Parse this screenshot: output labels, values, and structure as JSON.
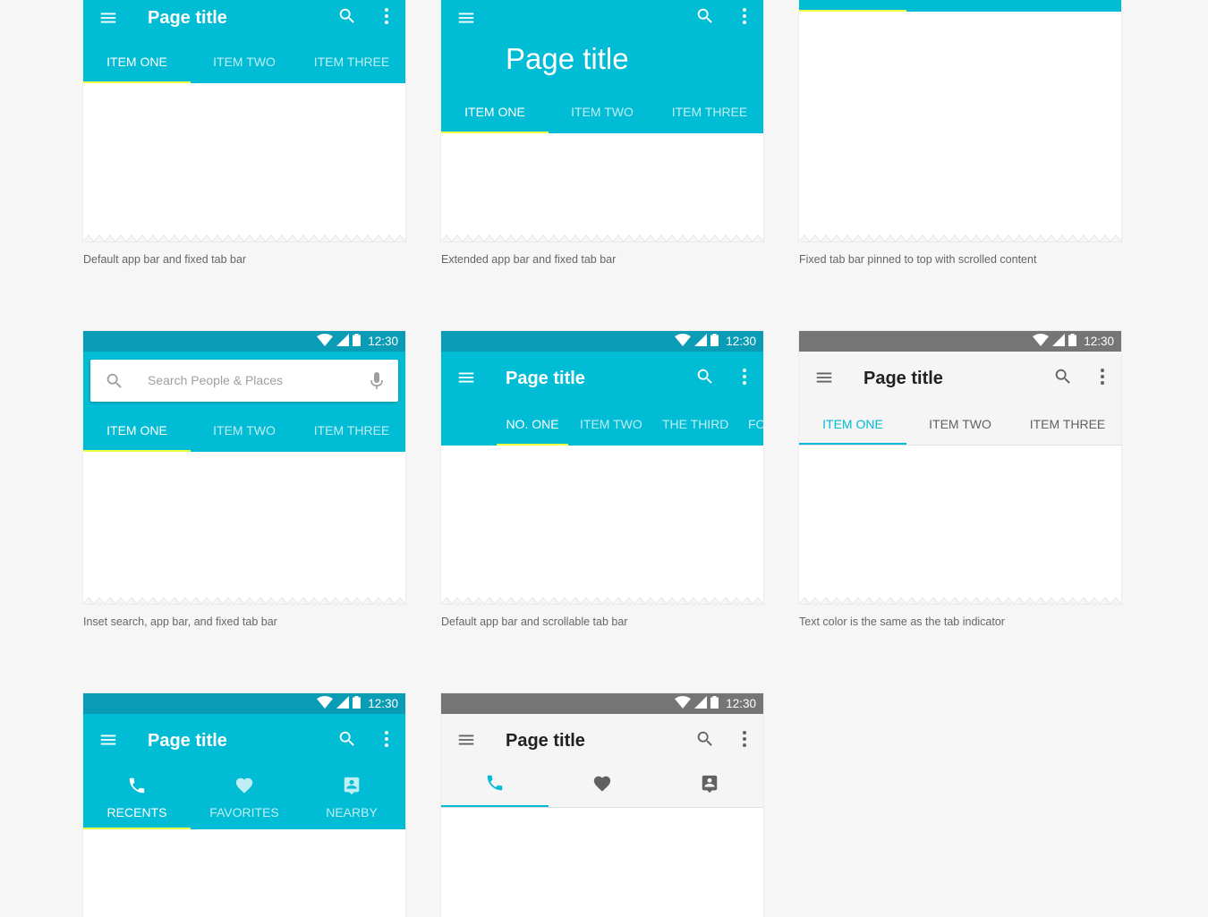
{
  "colors": {
    "primary": "#00bcd4",
    "primary_dark": "#0a9cb4",
    "indicator": "#eeff41",
    "gray_status": "#757575"
  },
  "status": {
    "time": "12:30"
  },
  "app_title": "Page title",
  "icons": {
    "menu": "menu-icon",
    "search": "search-icon",
    "more": "more-vert-icon",
    "wifi": "wifi-icon",
    "signal": "signal-icon",
    "battery": "battery-icon",
    "mic": "mic-icon",
    "phone": "phone-icon",
    "heart": "heart-icon",
    "contact": "contact-icon"
  },
  "examples": [
    {
      "caption": "Default app bar and fixed tab bar",
      "tabs": [
        "ITEM ONE",
        "ITEM TWO",
        "ITEM THREE"
      ]
    },
    {
      "caption": "Extended app bar and fixed tab bar",
      "tabs": [
        "ITEM ONE",
        "ITEM TWO",
        "ITEM THREE"
      ]
    },
    {
      "caption": "Fixed tab bar pinned to top with scrolled content"
    },
    {
      "caption": "Inset search, app bar, and fixed tab bar",
      "search_placeholder": "Search People  & Places",
      "tabs": [
        "ITEM ONE",
        "ITEM TWO",
        "ITEM THREE"
      ]
    },
    {
      "caption": "Default app bar and scrollable tab bar",
      "tabs": [
        "NO. ONE",
        "ITEM TWO",
        "THE THIRD",
        "FO"
      ]
    },
    {
      "caption": "Text color is the same as the tab indicator",
      "tabs": [
        "ITEM ONE",
        "ITEM TWO",
        "ITEM THREE"
      ]
    },
    {
      "tabs": [
        "RECENTS",
        "FAVORITES",
        "NEARBY"
      ]
    },
    {}
  ]
}
